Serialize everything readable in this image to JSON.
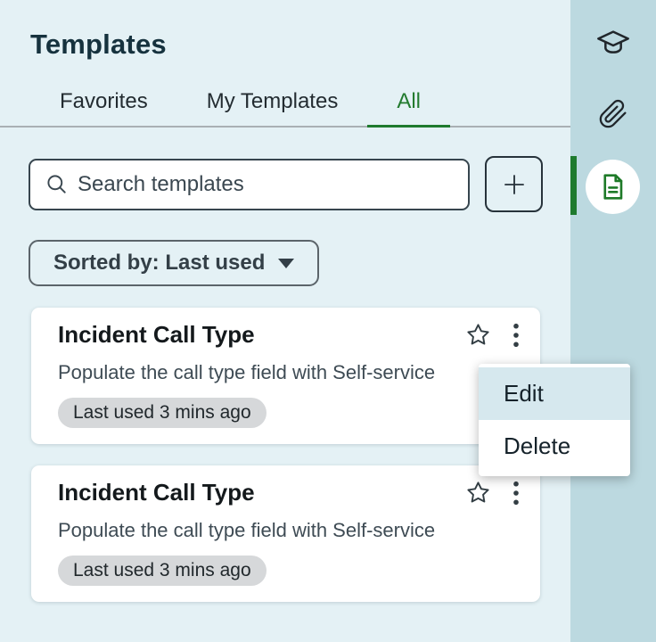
{
  "panel": {
    "title": "Templates",
    "tabs": [
      {
        "label": "Favorites",
        "active": false
      },
      {
        "label": "My Templates",
        "active": false
      },
      {
        "label": "All",
        "active": true
      }
    ],
    "search": {
      "placeholder": "Search templates",
      "value": "",
      "icon": "search-icon"
    },
    "add_button": {
      "icon": "plus-icon"
    },
    "sort_button": {
      "label": "Sorted by: Last used",
      "icon": "chevron-down-icon"
    },
    "cards": [
      {
        "title": "Incident Call Type",
        "description": "Populate the call type field with Self-service",
        "badge": "Last used 3 mins ago",
        "icons": [
          "star-icon",
          "kebab-menu-icon"
        ]
      },
      {
        "title": "Incident Call Type",
        "description": "Populate the call type field with Self-service",
        "badge": "Last used 3 mins ago",
        "icons": [
          "star-icon",
          "kebab-menu-icon"
        ]
      }
    ]
  },
  "context_menu": {
    "items": [
      {
        "label": "Edit",
        "highlighted": true
      },
      {
        "label": "Delete",
        "highlighted": false
      }
    ]
  },
  "sidebar": {
    "icons": [
      {
        "name": "graduation-cap-icon",
        "active": false
      },
      {
        "name": "paperclip-icon",
        "active": false
      },
      {
        "name": "document-icon",
        "active": true
      }
    ]
  },
  "colors": {
    "accent_green": "#237b2f",
    "underline_green": "#1e7a2e",
    "panel_bg": "#e4f1f5",
    "sidebar_bg": "#bcd9e0",
    "menu_highlight_bg": "#d6e8ee",
    "badge_bg": "#d6d8da",
    "title_text": "#16323e"
  }
}
